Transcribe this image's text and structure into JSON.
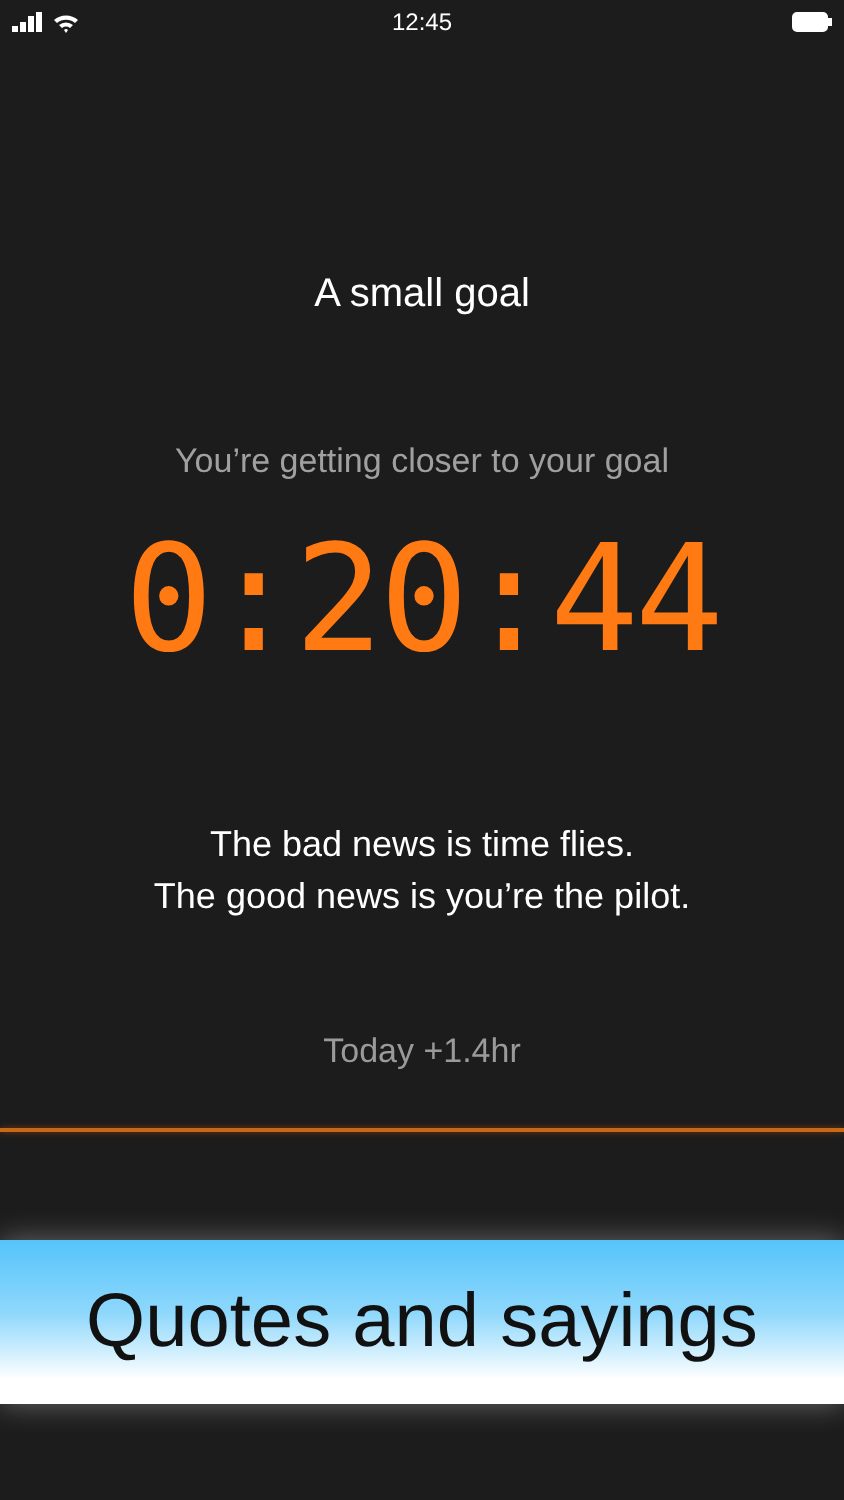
{
  "status_bar": {
    "time": "12:45"
  },
  "goal": {
    "title": "A small goal",
    "message": "You’re getting closer to your goal",
    "timer": "0:20:44"
  },
  "quote": {
    "lines": [
      "The bad news is time flies.",
      "The good news is you’re the pilot."
    ]
  },
  "today": "Today +1.4hr",
  "banner": {
    "caption": "Quotes and sayings"
  }
}
